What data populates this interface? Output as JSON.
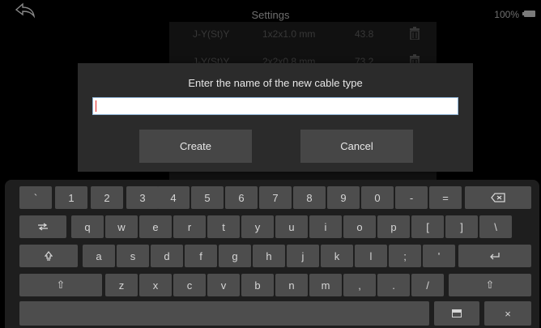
{
  "status_bar": {
    "title": "Settings",
    "battery": "100%",
    "icons": {
      "back": "back-arrow-icon",
      "battery": "battery-icon"
    }
  },
  "background_table": {
    "rows": [
      {
        "name": "J-Y(St)Y",
        "spec": "1x2x1.0 mm",
        "value": "43.8",
        "icon": "trash-icon"
      },
      {
        "name": "J-Y(St)Y",
        "spec": "2x2x0.8 mm",
        "value": "73.2",
        "icon": "trash-icon"
      }
    ]
  },
  "dialog": {
    "title": "Enter the name of the new cable type",
    "input_value": "",
    "create_label": "Create",
    "cancel_label": "Cancel"
  },
  "keyboard": {
    "row1": [
      "`",
      "1",
      "2",
      "3",
      "4",
      "5",
      "6",
      "7",
      "8",
      "9",
      "0",
      "-",
      "="
    ],
    "backspace_icon": "backspace-icon",
    "tab_icon": "tab-icon",
    "row2": [
      "q",
      "w",
      "e",
      "r",
      "t",
      "y",
      "u",
      "i",
      "o",
      "p",
      "[",
      "]",
      "\\"
    ],
    "capslock_icon": "caps-lock-icon",
    "row3": [
      "a",
      "s",
      "d",
      "f",
      "g",
      "h",
      "j",
      "k",
      "l",
      ";",
      "'"
    ],
    "enter_icon": "enter-icon",
    "shift_label": "⇧",
    "row4": [
      "z",
      "x",
      "c",
      "v",
      "b",
      "n",
      "m",
      ",",
      ".",
      "/"
    ],
    "close_label": "×",
    "layout_icon": "keyboard-layout-icon"
  },
  "colors": {
    "accent_caret": "#dd2222",
    "key": "#4d4d4d",
    "dialog": "#2b2b2b"
  }
}
